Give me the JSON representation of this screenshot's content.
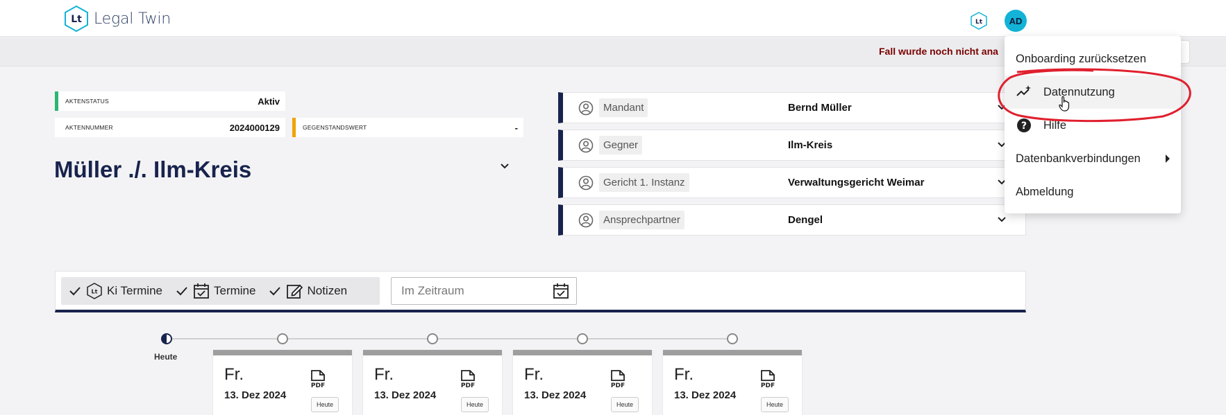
{
  "brand": {
    "name": "Legal Twin",
    "logo_text": "Lt"
  },
  "header": {
    "lt_badge": "Lt",
    "avatar_initials": "AD"
  },
  "subbar": {
    "warning": "Fall wurde noch nicht ana"
  },
  "fields": {
    "status_label": "AKTENSTATUS",
    "status_value": "Aktiv",
    "nummer_label": "AKTENNUMMER",
    "nummer_value": "2024000129",
    "wert_label": "GEGENSTANDSWERT",
    "wert_value": "-"
  },
  "case": {
    "title": "Müller ./. Ilm-Kreis"
  },
  "parties": [
    {
      "label": "Mandant",
      "value": "Bernd Müller"
    },
    {
      "label": "Gegner",
      "value": "Ilm-Kreis"
    },
    {
      "label": "Gericht 1. Instanz",
      "value": "Verwaltungsgericht Weimar"
    },
    {
      "label": "Ansprechpartner",
      "value": "Dengel"
    }
  ],
  "filters": {
    "chips": [
      {
        "label": "Ki Termine",
        "icon": "lt-hex-icon"
      },
      {
        "label": "Termine",
        "icon": "calendar-check-icon"
      },
      {
        "label": "Notizen",
        "icon": "note-edit-icon"
      }
    ],
    "date_placeholder": "Im Zeitraum"
  },
  "timeline": {
    "today_label": "Heute",
    "cards": [
      {
        "day": "Fr.",
        "date": "13. Dez 2024",
        "pdf": "PDF",
        "button": "Heute"
      },
      {
        "day": "Fr.",
        "date": "13. Dez 2024",
        "pdf": "PDF",
        "button": "Heute"
      },
      {
        "day": "Fr.",
        "date": "13. Dez 2024",
        "pdf": "PDF",
        "button": "Heute"
      },
      {
        "day": "Fr.",
        "date": "13. Dez 2024",
        "pdf": "PDF",
        "button": "Heute"
      }
    ]
  },
  "user_menu": {
    "items": [
      {
        "label": "Onboarding zurücksetzen"
      },
      {
        "label": "Datennutzung",
        "icon": "chart-sparkle-icon"
      },
      {
        "label": "Hilfe",
        "icon": "help-circle-icon"
      },
      {
        "label": "Datenbankverbindungen",
        "submenu": true
      },
      {
        "label": "Abmeldung"
      }
    ]
  },
  "colors": {
    "navy": "#18234d",
    "cyan": "#12b3d6",
    "green": "#2db573",
    "orange": "#f2a200",
    "warning_red": "#7a0000",
    "annotation_red": "#e0202e"
  }
}
